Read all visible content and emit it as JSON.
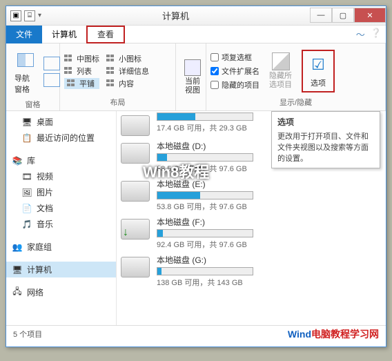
{
  "window": {
    "title": "计算机"
  },
  "menu": {
    "file": "文件",
    "computer": "计算机",
    "view": "查看"
  },
  "ribbon": {
    "panes": {
      "nav": "导航窗格",
      "group_label": "窗格"
    },
    "layout": {
      "medium_icons": "中图标",
      "small_icons": "小图标",
      "list": "列表",
      "details": "详细信息",
      "tiles": "平铺",
      "content": "内容",
      "group_label": "布局"
    },
    "current_view": {
      "label": "当前\n视图"
    },
    "show_hide": {
      "checkboxes": "项复选框",
      "extensions": "文件扩展名",
      "hidden": "隐藏的项目",
      "hide_selected": "隐藏所\n选项目",
      "group_label": "显示/隐藏"
    },
    "options": {
      "label": "选项"
    }
  },
  "tooltip": {
    "title": "选项",
    "body": "更改用于打开项目、文件和文件夹视图以及搜索等方面的设置。"
  },
  "sidebar": {
    "desktop": "桌面",
    "recent": "最近访问的位置",
    "libraries": "库",
    "videos": "视频",
    "pictures": "图片",
    "documents": "文档",
    "music": "音乐",
    "homegroup": "家庭组",
    "computer": "计算机",
    "network": "网络"
  },
  "drives": [
    {
      "name": "",
      "free": "17.4 GB 可用，共 29.3 GB",
      "pct": 40
    },
    {
      "name": "本地磁盘 (D:)",
      "free": "88.5 GB 可用，共 97.6 GB",
      "pct": 10
    },
    {
      "name": "本地磁盘 (E:)",
      "free": "53.8 GB 可用，共 97.6 GB",
      "pct": 45
    },
    {
      "name": "本地磁盘 (F:)",
      "free": "92.4 GB 可用，共 97.6 GB",
      "pct": 6
    },
    {
      "name": "本地磁盘 (G:)",
      "free": "138 GB 可用，共 143 GB",
      "pct": 4
    }
  ],
  "status": {
    "items": "5 个项目"
  },
  "watermark": {
    "a": "Wind",
    "b": "电脑教程学习网"
  },
  "overlay": "Win8教程"
}
